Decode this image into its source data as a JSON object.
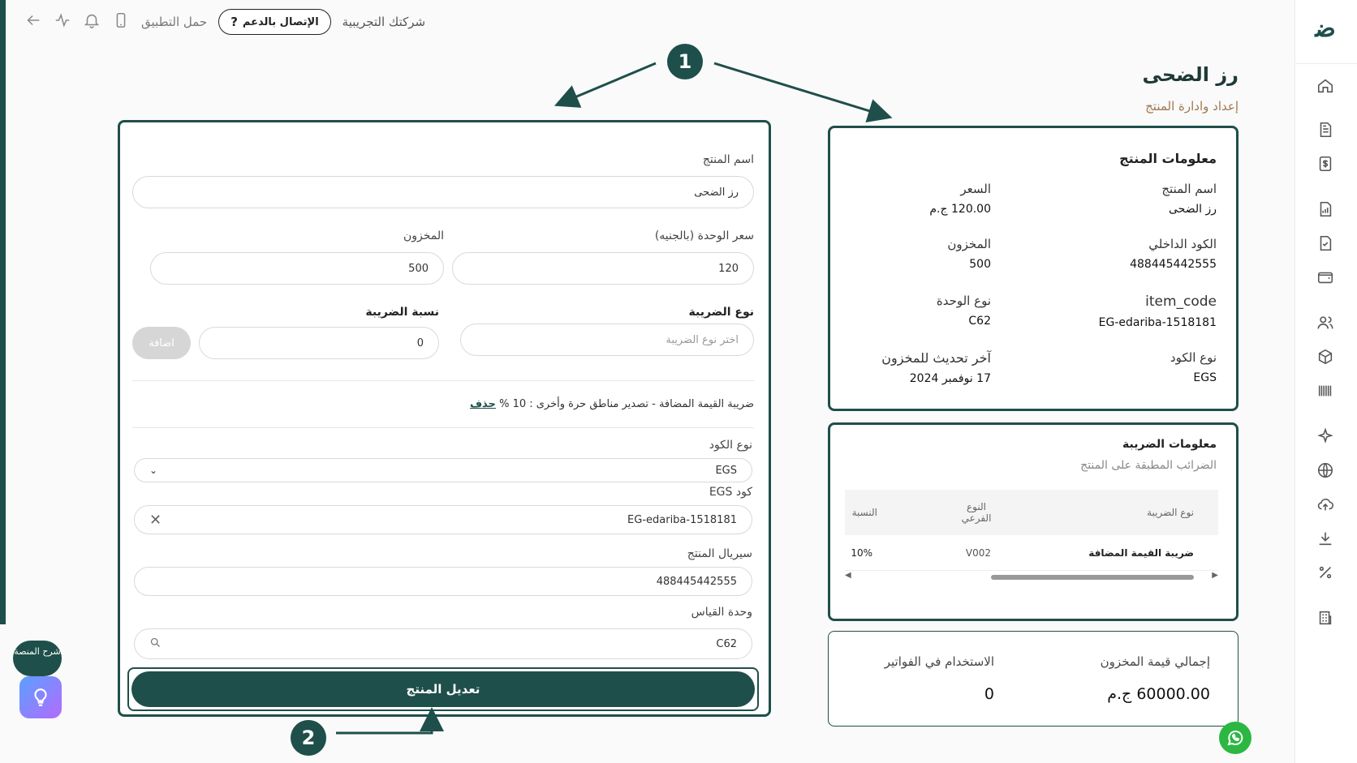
{
  "topbar": {
    "company": "شركتك التجريبية",
    "support_label": "الإتصال بالدعم",
    "download_app": "حمل التطبيق"
  },
  "page": {
    "title": "رز الضحى",
    "subtitle": "إعداد وادارة المنتج"
  },
  "info": {
    "title": "معلومات المنتج",
    "name_label": "اسم المنتج",
    "name_value": "رز الضحى",
    "price_label": "السعر",
    "price_value": "120.00 ج.م",
    "internal_code_label": "الكود الداخلي",
    "internal_code_value": "488445442555",
    "stock_label": "المخزون",
    "stock_value": "500",
    "item_code_label": "item_code",
    "item_code_value": "EG-edariba-1518181",
    "unit_type_label": "نوع الوحدة",
    "unit_type_value": "C62",
    "code_type_label": "نوع الكود",
    "code_type_value": "EGS",
    "last_update_label": "آخر تحديث للمخزون",
    "last_update_value": "17 نوفمبر 2024"
  },
  "tax_info": {
    "title": "معلومات الضريبة",
    "subtitle": "الضرائب المطبقة على المنتج",
    "col_type": "نوع الضريبة",
    "col_subtype": "النوع الفرعي",
    "col_rate": "النسبة",
    "row_type": "ضريبة القيمة المضافة",
    "row_subtype": "V002",
    "row_rate": "10%"
  },
  "totals": {
    "stock_value_label": "إجمالي قيمة المخزون",
    "stock_value": "60000.00 ج.م",
    "invoice_usage_label": "الاستخدام في الفواتير",
    "invoice_usage": "0"
  },
  "form": {
    "name_label": "اسم المنتج",
    "name_value": "رز الضحى",
    "unit_price_label": "سعر الوحدة (بالجنيه)",
    "unit_price_value": "120",
    "stock_label": "المخزون",
    "stock_value": "500",
    "tax_type_label": "نوع الضريبة",
    "tax_type_placeholder": "اختر نوع الضريبة",
    "tax_rate_label": "نسبة الضريبة",
    "tax_rate_value": "0",
    "add_label": "اضافة",
    "tax_line": "ضريبة القيمة المضافة - تصدير مناطق حرة وأخرى : 10 %",
    "delete_label": "حذف",
    "code_type_label": "نوع الكود",
    "code_type_value": "EGS",
    "egs_code_label": "كود EGS",
    "egs_code_value": "EG-edariba-1518181",
    "serial_label": "سيريال المنتج",
    "serial_value": "488445442555",
    "uom_label": "وحدة القياس",
    "uom_value": "C62",
    "submit_label": "تعديل المنتج"
  },
  "markers": {
    "m1": "1",
    "m2": "2"
  },
  "help": {
    "label": "شرح المنصة"
  },
  "colors": {
    "primary": "#1f4f4a",
    "accent": "#a07850"
  }
}
